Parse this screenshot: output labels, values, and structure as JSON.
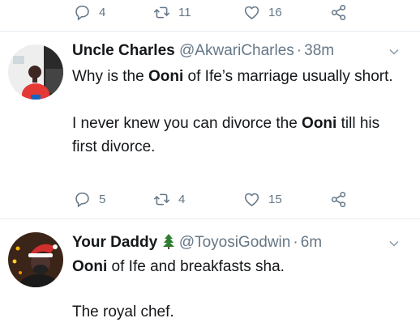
{
  "top_actions": {
    "reply_count": "4",
    "retweet_count": "11",
    "like_count": "16"
  },
  "tweets": [
    {
      "name": "Uncle Charles",
      "handle": "@AkwariCharles",
      "separator": "·",
      "time": "38m",
      "line1_a": "Why is the ",
      "line1_bold": "Ooni",
      "line1_b": " of Ife’s marriage usually short.",
      "line2_a": "I never knew you can divorce the ",
      "line2_bold": "Ooni",
      "line2_b": " till his first divorce.",
      "reply_count": "5",
      "retweet_count": "4",
      "like_count": "15"
    },
    {
      "name": "Your Daddy",
      "name_emoji": "christmas-tree-icon",
      "handle": "@ToyosiGodwin",
      "separator": "·",
      "time": "6m",
      "line1_bold": "Ooni",
      "line1_b": " of Ife and breakfasts sha.",
      "line2": "The royal chef."
    }
  ],
  "colors": {
    "text": "#14171a",
    "muted": "#657786",
    "divider": "#e6ecf0",
    "tree": "#2e7d32"
  }
}
